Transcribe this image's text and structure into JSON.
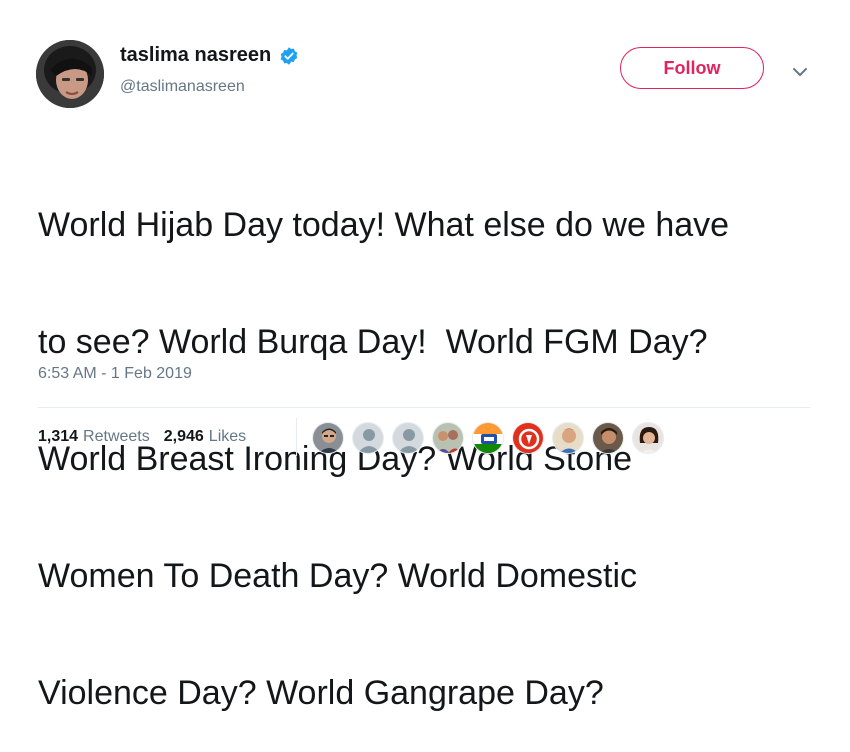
{
  "user": {
    "display_name": "taslima nasreen",
    "handle": "@taslimanasreen",
    "verified": true
  },
  "actions": {
    "follow_label": "Follow",
    "menu_icon": "chevron-down-icon"
  },
  "tweet": {
    "lines": [
      "World Hijab Day today! What else do we have",
      "to see? World Burqa Day!  World FGM Day?",
      "World Breast Ironing Day? World Stone",
      "Women To Death Day? World Domestic",
      "Violence Day? World Gangrape Day?"
    ],
    "timestamp": "6:53 AM - 1 Feb 2019"
  },
  "stats": {
    "retweets_count": "1,314",
    "retweets_label": "Retweets",
    "likes_count": "2,946",
    "likes_label": "Likes"
  },
  "liked_by_avatars": [
    "user-photo-avatar",
    "default-avatar",
    "default-avatar",
    "group-photo-avatar",
    "flag-logo-avatar",
    "red-logo-avatar",
    "user-photo-avatar",
    "user-photo-avatar",
    "user-photo-avatar"
  ],
  "colors": {
    "accent": "#e0245e",
    "verified_blue": "#1da1f2",
    "text_primary": "#14171a",
    "text_secondary": "#657786"
  }
}
